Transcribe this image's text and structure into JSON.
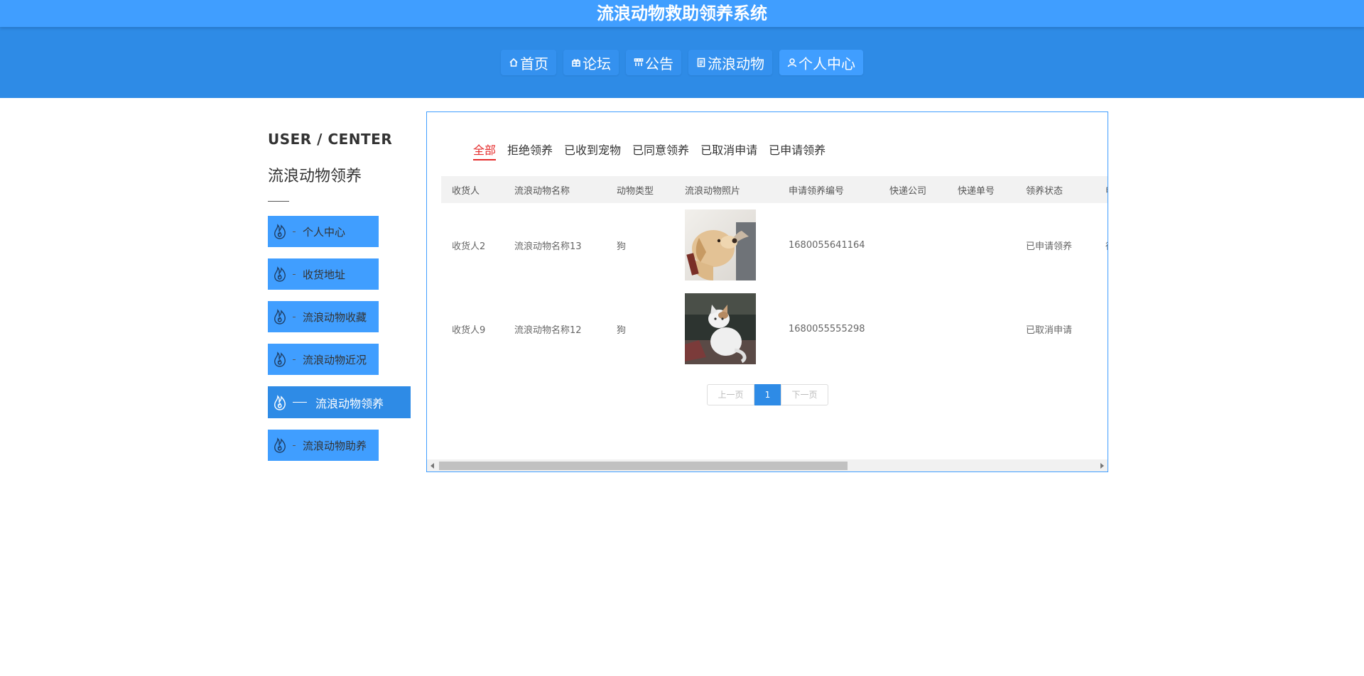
{
  "site": {
    "title": "流浪动物救助领养系统"
  },
  "nav": {
    "items": [
      {
        "label": "首页",
        "icon": "home-icon"
      },
      {
        "label": "论坛",
        "icon": "gift-icon"
      },
      {
        "label": "公告",
        "icon": "grid-icon"
      },
      {
        "label": "流浪动物",
        "icon": "document-icon"
      },
      {
        "label": "个人中心",
        "icon": "user-icon",
        "active": true
      }
    ]
  },
  "sidebar": {
    "title_en": "USER / CENTER",
    "title_zh": "流浪动物领养",
    "items": [
      {
        "label": "个人中心"
      },
      {
        "label": "收货地址"
      },
      {
        "label": "流浪动物收藏"
      },
      {
        "label": "流浪动物近况"
      },
      {
        "label": "流浪动物领养",
        "active": true
      },
      {
        "label": "流浪动物助养"
      }
    ]
  },
  "tabs": [
    "全部",
    "拒绝领养",
    "已收到宠物",
    "已同意领养",
    "已取消申请",
    "已申请领养"
  ],
  "table": {
    "headers": [
      "收货人",
      "流浪动物名称",
      "动物类型",
      "流浪动物照片",
      "申请领养编号",
      "快递公司",
      "快递单号",
      "领养状态",
      "申"
    ],
    "rows": [
      {
        "receiver": "收货人2",
        "name": "流浪动物名称13",
        "type": "狗",
        "photo": "dog-photo",
        "number": "1680055641164",
        "company": "",
        "tracking": "",
        "status": "已申请领养",
        "extra": "待"
      },
      {
        "receiver": "收货人9",
        "name": "流浪动物名称12",
        "type": "狗",
        "photo": "cat-photo",
        "number": "1680055555298",
        "company": "",
        "tracking": "",
        "status": "已取消申请",
        "extra": ""
      }
    ]
  },
  "pager": {
    "prev": "上一页",
    "current": "1",
    "next": "下一页"
  }
}
